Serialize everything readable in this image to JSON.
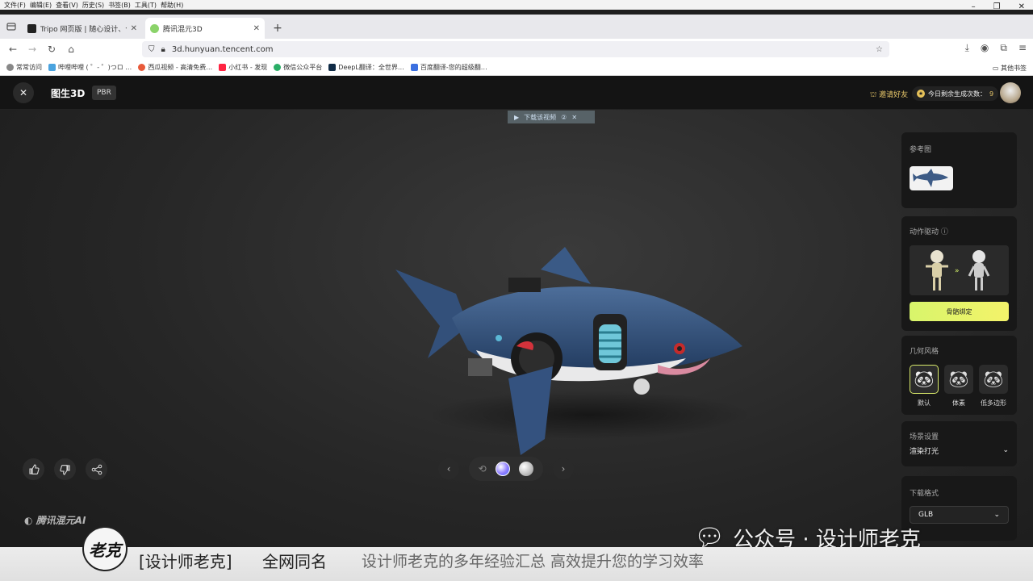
{
  "menubar": {
    "items": [
      "文件(F)",
      "编辑(E)",
      "查看(V)",
      "历史(S)",
      "书签(B)",
      "工具(T)",
      "帮助(H)"
    ]
  },
  "window_controls": {
    "minimize": "–",
    "restore": "❐",
    "close": "✕"
  },
  "tabs": [
    {
      "title": "Tripo 网页版 | 随心设计、个性…",
      "active": false,
      "favicon_color": "#222222"
    },
    {
      "title": "腾讯混元3D",
      "active": true,
      "favicon_color": "#8bd36a"
    }
  ],
  "newtab": "+",
  "nav": {
    "url": "3d.hunyuan.tencent.com"
  },
  "bookmarks": [
    {
      "label": "常常访问",
      "color": "#888888"
    },
    {
      "label": "哔哩哔哩 ( ゜- ゜)つロ …",
      "color": "#4aa3df"
    },
    {
      "label": "西瓜视频 - 高清免费…",
      "color": "#e85a3a"
    },
    {
      "label": "小红书 - 发现",
      "color": "#ff2442"
    },
    {
      "label": "微信公众平台",
      "color": "#2aae67"
    },
    {
      "label": "DeepL翻译：全世界…",
      "color": "#0f2b46"
    },
    {
      "label": "百度翻译-您的超级翻…",
      "color": "#3b6fe0"
    }
  ],
  "bookmarks_other": "其他书签",
  "app": {
    "title": "图生3D",
    "badge": "PBR",
    "invite": "邀请好友",
    "credits_label": "今日剩余生成次数：",
    "credits_value": "9",
    "download_video": "下载该视频",
    "download_video_num": "②",
    "logo": "腾讯混元AI",
    "colors": {
      "accent": "#d8f56b",
      "panel": "#181818",
      "gold": "#e8c76a"
    }
  },
  "panels": {
    "reference": {
      "title": "参考图"
    },
    "animation": {
      "title": "动作驱动",
      "button": "骨骼绑定"
    },
    "geometry": {
      "title": "几何风格",
      "options": [
        "默认",
        "体素",
        "低多边形"
      ],
      "selected": "默认"
    },
    "scene": {
      "title": "场景设置",
      "value": "渲染打光"
    },
    "format": {
      "title": "下载格式",
      "value": "GLB"
    }
  },
  "overlay": {
    "watermark": "公众号 · 设计师老克",
    "banner_logo": "老克",
    "banner_name": "[设计师老克]",
    "banner_same": "全网同名",
    "banner_slogan": "设计师老克的多年经验汇总  高效提升您的学习效率"
  }
}
